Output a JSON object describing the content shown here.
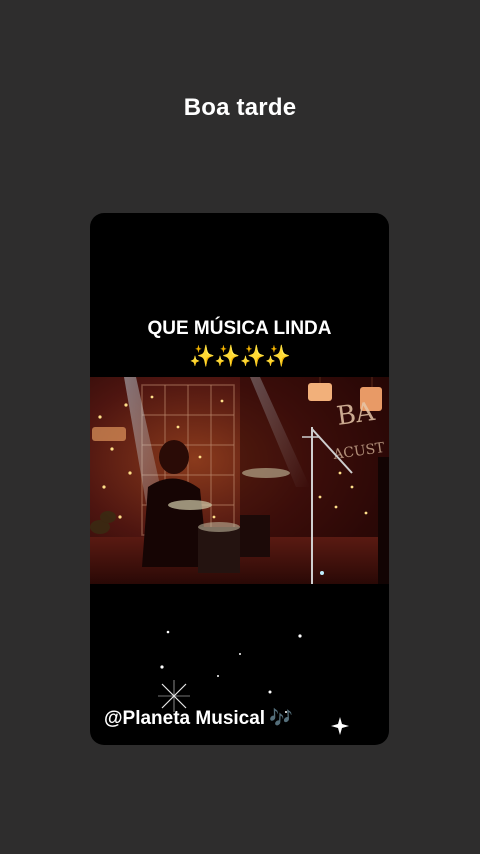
{
  "header": {
    "greeting": "Boa tarde"
  },
  "post": {
    "caption": "QUE MÚSICA LINDA",
    "caption_emoji": "✨✨✨✨",
    "credit": "@Planeta Musical",
    "credit_icon": "musical-notes-icon",
    "credit_icon_glyph": "🎶"
  },
  "colors": {
    "background": "#2e2d2d",
    "card": "#000000",
    "sparkle": "#ffd23d",
    "note_icon": "#7fc4f5"
  }
}
